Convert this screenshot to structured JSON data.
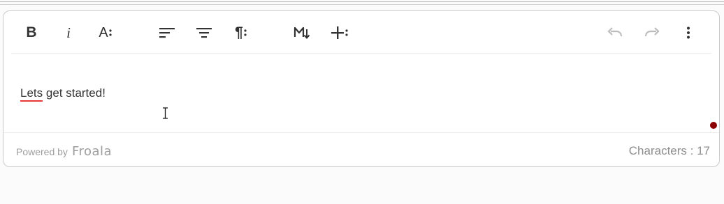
{
  "toolbar": {
    "buttons": [
      {
        "name": "bold",
        "icon": "bold-icon",
        "glyph": "B"
      },
      {
        "name": "italic",
        "icon": "italic-icon",
        "glyph": "i"
      },
      {
        "name": "font-size",
        "icon": "font-size-icon",
        "glyph": "A"
      },
      {
        "name": "align-left",
        "icon": "align-left-icon"
      },
      {
        "name": "align-center",
        "icon": "align-center-icon"
      },
      {
        "name": "paragraph-format",
        "icon": "paragraph-icon",
        "glyph": "¶"
      },
      {
        "name": "markdown",
        "icon": "markdown-icon",
        "glyph": "M"
      },
      {
        "name": "insert-more",
        "icon": "plus-icon"
      },
      {
        "name": "undo",
        "icon": "undo-icon",
        "disabled": true
      },
      {
        "name": "redo",
        "icon": "redo-icon",
        "disabled": true
      },
      {
        "name": "more-options",
        "icon": "more-vertical-icon"
      }
    ]
  },
  "content": {
    "misspelled_word": "Lets",
    "rest_text": " get started!"
  },
  "footer": {
    "powered_by_label": "Powered by",
    "brand": "Froala",
    "char_count_label": "Characters : 17"
  },
  "colors": {
    "text": "#333333",
    "icon": "#333333",
    "icon_disabled": "#bdbdbd",
    "spellcheck_underline": "#e53935",
    "status_dot": "#8b0000",
    "footer_text": "#9e9e9e"
  }
}
